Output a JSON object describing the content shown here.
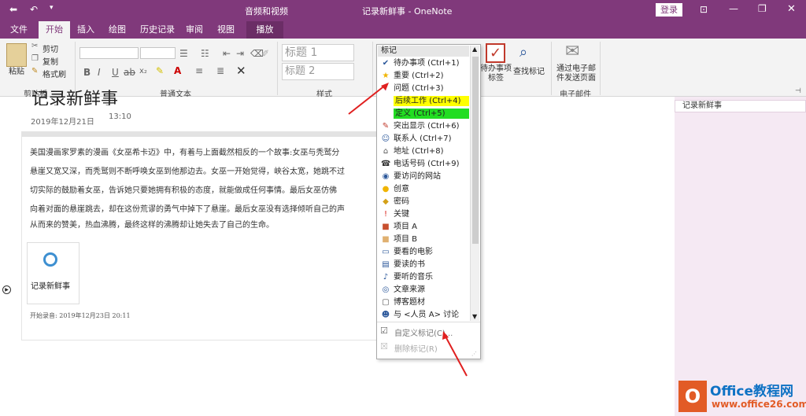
{
  "titlebar": {
    "context_tab": "音频和视频",
    "title": "记录新鲜事 - OneNote",
    "signin": "登录"
  },
  "tabs": [
    {
      "label": "文件"
    },
    {
      "label": "开始"
    },
    {
      "label": "插入"
    },
    {
      "label": "绘图"
    },
    {
      "label": "历史记录"
    },
    {
      "label": "审阅"
    },
    {
      "label": "视图"
    },
    {
      "label": "播放"
    }
  ],
  "clipboard": {
    "paste": "粘贴",
    "cut": "剪切",
    "copy": "复制",
    "format": "格式刷",
    "group": "剪贴板"
  },
  "text": {
    "group": "普通文本",
    "bold": "B",
    "italic": "I",
    "underline": "U"
  },
  "styles": {
    "h1": "标题 1",
    "h2": "标题 2",
    "group": "样式"
  },
  "tags_btn": {
    "todo": "待办事项标签",
    "find": "查找标记"
  },
  "email": {
    "send": "通过电子邮件发送页面",
    "group": "电子邮件"
  },
  "tags_dropdown": {
    "header": "标记",
    "items": [
      {
        "label": "待办事项 (Ctrl+1)",
        "icon": "✔",
        "color": "#2b579a"
      },
      {
        "label": "重要 (Ctrl+2)",
        "icon": "★",
        "color": "#f0b400"
      },
      {
        "label": "问题 (Ctrl+3)",
        "icon": "?",
        "color": "#8a3cb3"
      },
      {
        "label": "后续工作 (Ctrl+4)",
        "icon": "",
        "color": "#ffff00"
      },
      {
        "label": "定义 (Ctrl+5)",
        "icon": "",
        "color": "#22dd22"
      },
      {
        "label": "突出显示 (Ctrl+6)",
        "icon": "✎",
        "color": "#c0392b"
      },
      {
        "label": "联系人 (Ctrl+7)",
        "icon": "☺",
        "color": "#2b579a"
      },
      {
        "label": "地址 (Ctrl+8)",
        "icon": "⌂",
        "color": "#555"
      },
      {
        "label": "电话号码 (Ctrl+9)",
        "icon": "☎",
        "color": "#333"
      },
      {
        "label": "要访问的网站",
        "icon": "◉",
        "color": "#2b579a"
      },
      {
        "label": "创意",
        "icon": "●",
        "color": "#f0b400"
      },
      {
        "label": "密码",
        "icon": "◆",
        "color": "#d4a017"
      },
      {
        "label": "关键",
        "icon": "!",
        "color": "#d9241c"
      },
      {
        "label": "项目 A",
        "icon": "■",
        "color": "#c8502f"
      },
      {
        "label": "项目 B",
        "icon": "■",
        "color": "#e0b070"
      },
      {
        "label": "要看的电影",
        "icon": "▭",
        "color": "#2b579a"
      },
      {
        "label": "要读的书",
        "icon": "▤",
        "color": "#2b579a"
      },
      {
        "label": "要听的音乐",
        "icon": "♪",
        "color": "#2b579a"
      },
      {
        "label": "文章来源",
        "icon": "◎",
        "color": "#2b579a"
      },
      {
        "label": "博客题材",
        "icon": "▢",
        "color": "#555"
      },
      {
        "label": "与 <人员 A> 讨论",
        "icon": "☻",
        "color": "#2b579a"
      }
    ],
    "custom": "自定义标记(C)...",
    "remove": "删除标记(R)"
  },
  "page": {
    "title": "记录新鲜事",
    "date": "2019年12月21日",
    "time": "13:10",
    "lines": [
      "美国漫画家罗素的漫画《女巫希卡迈》中，有着与上面截然相反的一个故事:女巫与秃鹫分",
      "悬崖又宽又深，而秃鹫则不断呼唤女巫到他那边去。女巫一开始觉得，峡谷太宽，她跳不过",
      "切实际的鼓励着女巫，告诉她只要她拥有积极的态度，就能做成任何事情。最后女巫仿佛",
      "向着对面的悬崖跳去，却在这份荒谬的勇气中掉下了悬崖。最后女巫没有选择倾听自己的声",
      "从而来的赞美，热血沸腾，最终这样的沸腾却让她失去了自己的生命。"
    ],
    "audio_label": "记录新鲜事",
    "recording": "开始录音: 2019年12月23日 20:11"
  },
  "right_pane": {
    "page_title": "记录新鲜事"
  },
  "watermark": {
    "brand": "Office教程网",
    "url": "www.office26.com"
  }
}
